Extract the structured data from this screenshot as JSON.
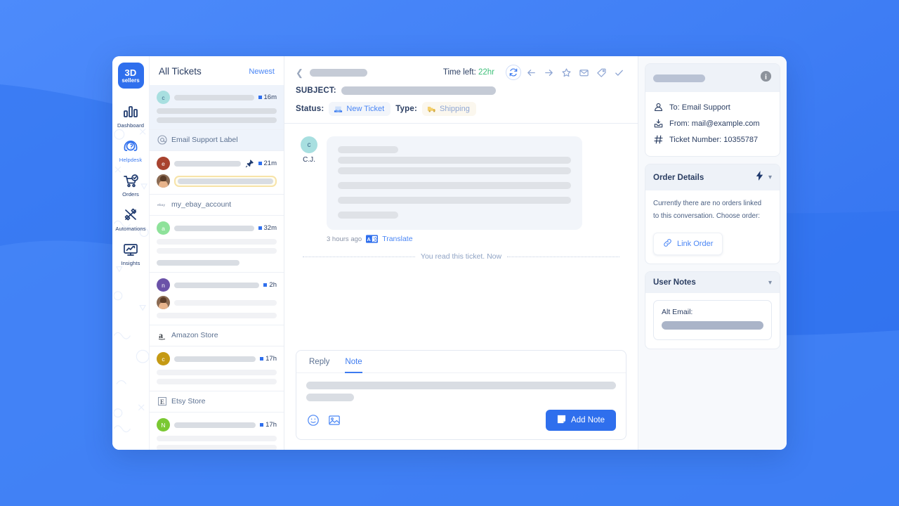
{
  "brand": {
    "line1": "3D",
    "line2": "sellers"
  },
  "nav": {
    "items": [
      {
        "label": "Dashboard",
        "icon": "bar-chart-icon",
        "active": false
      },
      {
        "label": "Helpdesk",
        "icon": "headset-question-icon",
        "active": true
      },
      {
        "label": "Orders",
        "icon": "cart-check-icon",
        "active": false
      },
      {
        "label": "Automations",
        "icon": "crossed-wands-icon",
        "active": false
      },
      {
        "label": "Insights",
        "icon": "monitor-chart-icon",
        "active": false
      }
    ]
  },
  "ticket_list": {
    "title": "All Tickets",
    "sort_label": "Newest",
    "tickets": [
      {
        "avatar_letter": "c",
        "avatar_color": "#a8dfe0",
        "time": "16m",
        "unread": true,
        "selected": true,
        "pinned": false,
        "photo": false
      },
      {
        "avatar_letter": "e",
        "avatar_color": "#a8432f",
        "time": "21m",
        "unread": true,
        "selected": false,
        "pinned": true,
        "photo": false
      },
      {
        "avatar_letter": "a",
        "avatar_color": "#8ee29a",
        "time": "32m",
        "unread": true,
        "selected": false,
        "pinned": false,
        "photo": false
      },
      {
        "avatar_letter": "n",
        "avatar_color": "#6b52a8",
        "time": "2h",
        "unread": true,
        "selected": false,
        "pinned": false,
        "photo": false
      },
      {
        "avatar_letter": "c",
        "avatar_color": "#c59a14",
        "time": "17h",
        "unread": true,
        "selected": false,
        "pinned": false,
        "photo": false
      },
      {
        "avatar_letter": "N",
        "avatar_color": "#7ac832",
        "time": "17h",
        "unread": true,
        "selected": false,
        "pinned": false,
        "photo": false
      }
    ],
    "stores": [
      {
        "name": "Email Support Label",
        "icon": "at-sign-icon"
      },
      {
        "name": "my_ebay_account",
        "icon": "ebay-logo-icon"
      },
      {
        "name": "Amazon Store",
        "icon": "amazon-logo-icon"
      },
      {
        "name": "Etsy Store",
        "icon": "etsy-logo-icon"
      }
    ]
  },
  "conversation": {
    "time_left_label": "Time left:",
    "time_left_value": "22hr",
    "subject_label": "SUBJECT:",
    "status_label": "Status:",
    "status_value": "New Ticket",
    "type_label": "Type:",
    "type_value": "Shipping",
    "toolbar_icons": [
      "refresh-icon",
      "arrow-left-icon",
      "arrow-right-icon",
      "star-icon",
      "envelope-icon",
      "tag-icon",
      "check-icon"
    ],
    "message": {
      "author_initial": "c",
      "author_name": "C.J.",
      "timestamp": "3 hours ago",
      "translate_label": "Translate"
    },
    "read_divider": "You read this ticket. Now",
    "composer": {
      "tabs": [
        {
          "label": "Reply",
          "active": false
        },
        {
          "label": "Note",
          "active": true
        }
      ],
      "emoji_icon": "emoji-icon",
      "image_icon": "image-icon",
      "submit_label": "Add Note",
      "submit_icon": "note-icon"
    }
  },
  "right_panel": {
    "contact": {
      "info_icon": "info-icon",
      "rows": [
        {
          "icon": "person-icon",
          "text": "To: Email Support"
        },
        {
          "icon": "inbox-icon",
          "text": "From: mail@example.com"
        },
        {
          "icon": "hash-icon",
          "text": "Ticket Number: 10355787"
        }
      ]
    },
    "order_details": {
      "title": "Order Details",
      "bolt_icon": "lightning-icon",
      "chevron_icon": "chevron-down-icon",
      "note_line1": "Currently there are no orders linked",
      "note_line2": "to this conversation. Choose order:",
      "link_button_label": "Link Order",
      "link_button_icon": "link-icon"
    },
    "user_notes": {
      "title": "User Notes",
      "chevron_icon": "chevron-down-icon",
      "note_label": "Alt Email:"
    }
  },
  "colors": {
    "brand_blue": "#2f6fed",
    "accent_link": "#4a86f5",
    "navy_text": "#2b3e62",
    "green": "#3fc07a",
    "page_bg": "#4285f9"
  }
}
